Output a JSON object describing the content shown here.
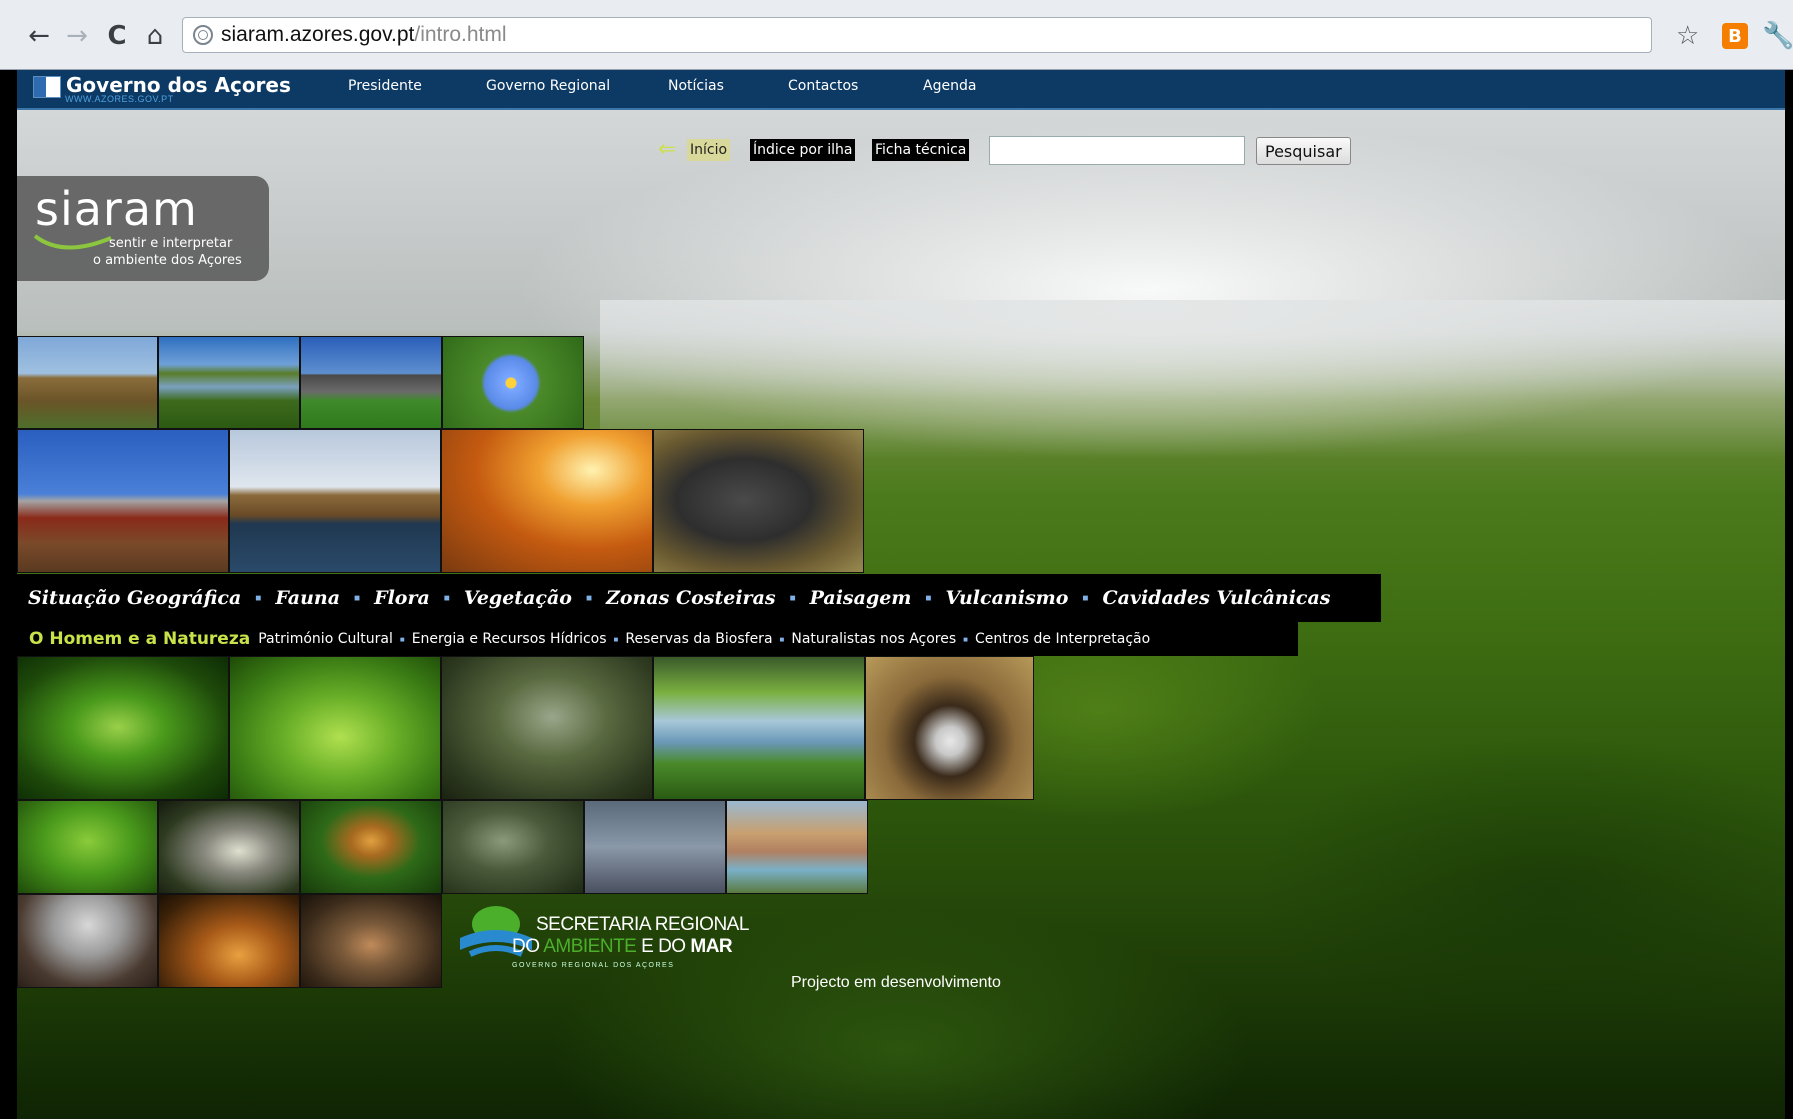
{
  "browser": {
    "url_host": "siaram.azores.gov.pt",
    "url_path": "/intro.html",
    "back_icon": "←",
    "forward_icon": "→",
    "reload_icon": "C",
    "home_icon": "⌂",
    "star_icon": "☆",
    "extension_label": "B",
    "wrench_icon": "🔧"
  },
  "govbar": {
    "title": "Governo dos Açores",
    "subtitle": "WWW.AZORES.GOV.PT",
    "nav": [
      "Presidente",
      "Governo Regional",
      "Notícias",
      "Contactos",
      "Agenda"
    ]
  },
  "toplinks": {
    "back_arrow": "⇐",
    "inicio": "Início",
    "indice": "Índice por ilha",
    "ficha": "Ficha técnica",
    "search_button": "Pesquisar",
    "search_value": ""
  },
  "siaram": {
    "word": "siaram",
    "tagline1": "sentir e interpretar",
    "tagline2": "o ambiente dos Açores"
  },
  "categories": [
    "Situação Geográfica",
    "Fauna",
    "Flora",
    "Vegetação",
    "Zonas Costeiras",
    "Paisagem",
    "Vulcanismo",
    "Cavidades Vulcânicas"
  ],
  "subcategories": {
    "main": "O Homem e a Natureza",
    "items": [
      "Património Cultural",
      "Energia e Recursos Hídricos",
      "Reservas da Biosfera",
      "Naturalistas nos Açores",
      "Centros de Interpretação"
    ]
  },
  "secretaria": {
    "line1": "SECRETARIA REGIONAL",
    "line2_a": "DO ",
    "line2_b": "AMBIENTE",
    "line2_c": " E DO ",
    "line2_d": "MAR",
    "line3": "GOVERNO REGIONAL DOS AÇORES"
  },
  "footer_note": "Projecto em desenvolvimento",
  "colors": {
    "govbar": "#0d3a64",
    "accent_green": "#c8e34a",
    "separator_blue": "#7fb0e6"
  }
}
